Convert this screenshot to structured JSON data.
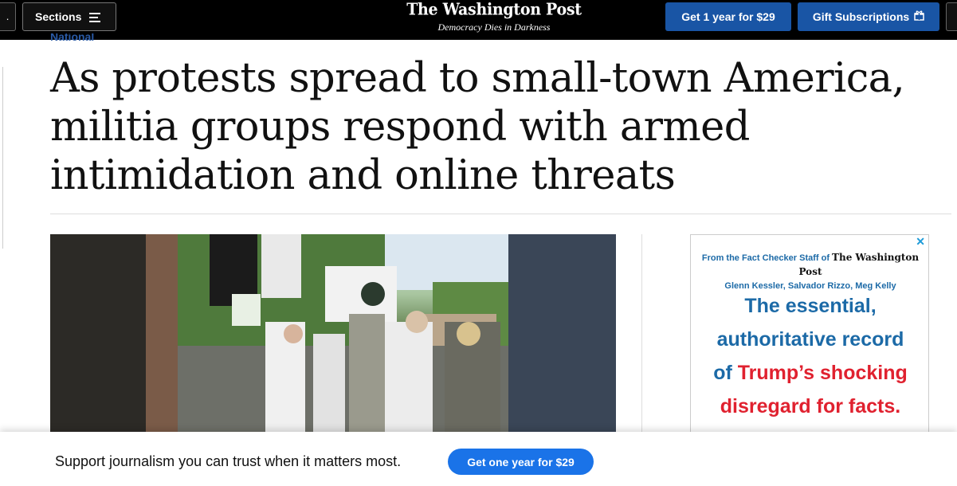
{
  "header": {
    "sections_label": "Sections",
    "logo_text": "The Washington Post",
    "tagline": "Democracy Dies in Darkness",
    "subscribe_label": "Get 1 year for $29",
    "gift_label": "Gift Subscriptions",
    "menu_icon": "hamburger-icon",
    "gift_icon": "gift-icon"
  },
  "article": {
    "kicker": "National",
    "headline": "As protests spread to small-town America, militia groups respond with armed intimidation and online threats"
  },
  "ad": {
    "close_symbol": "✕",
    "from_line": "From the Fact Checker Staff of",
    "brand": "The Washington Post",
    "authors": "Glenn Kessler, Salvador Rizzo, Meg Kelly",
    "line1": "The essential,",
    "line2": "authoritative record",
    "line3_prefix": "of ",
    "line3_highlight": "Trump’s shocking",
    "line4": "disregard for facts."
  },
  "banner": {
    "text": "Support journalism you can trust when it matters most.",
    "button_label": "Get one year for $29"
  },
  "colors": {
    "brand_blue": "#1955a5",
    "banner_button": "#1a73e8",
    "ad_blue": "#1c6aa7",
    "ad_red": "#e0212f"
  }
}
